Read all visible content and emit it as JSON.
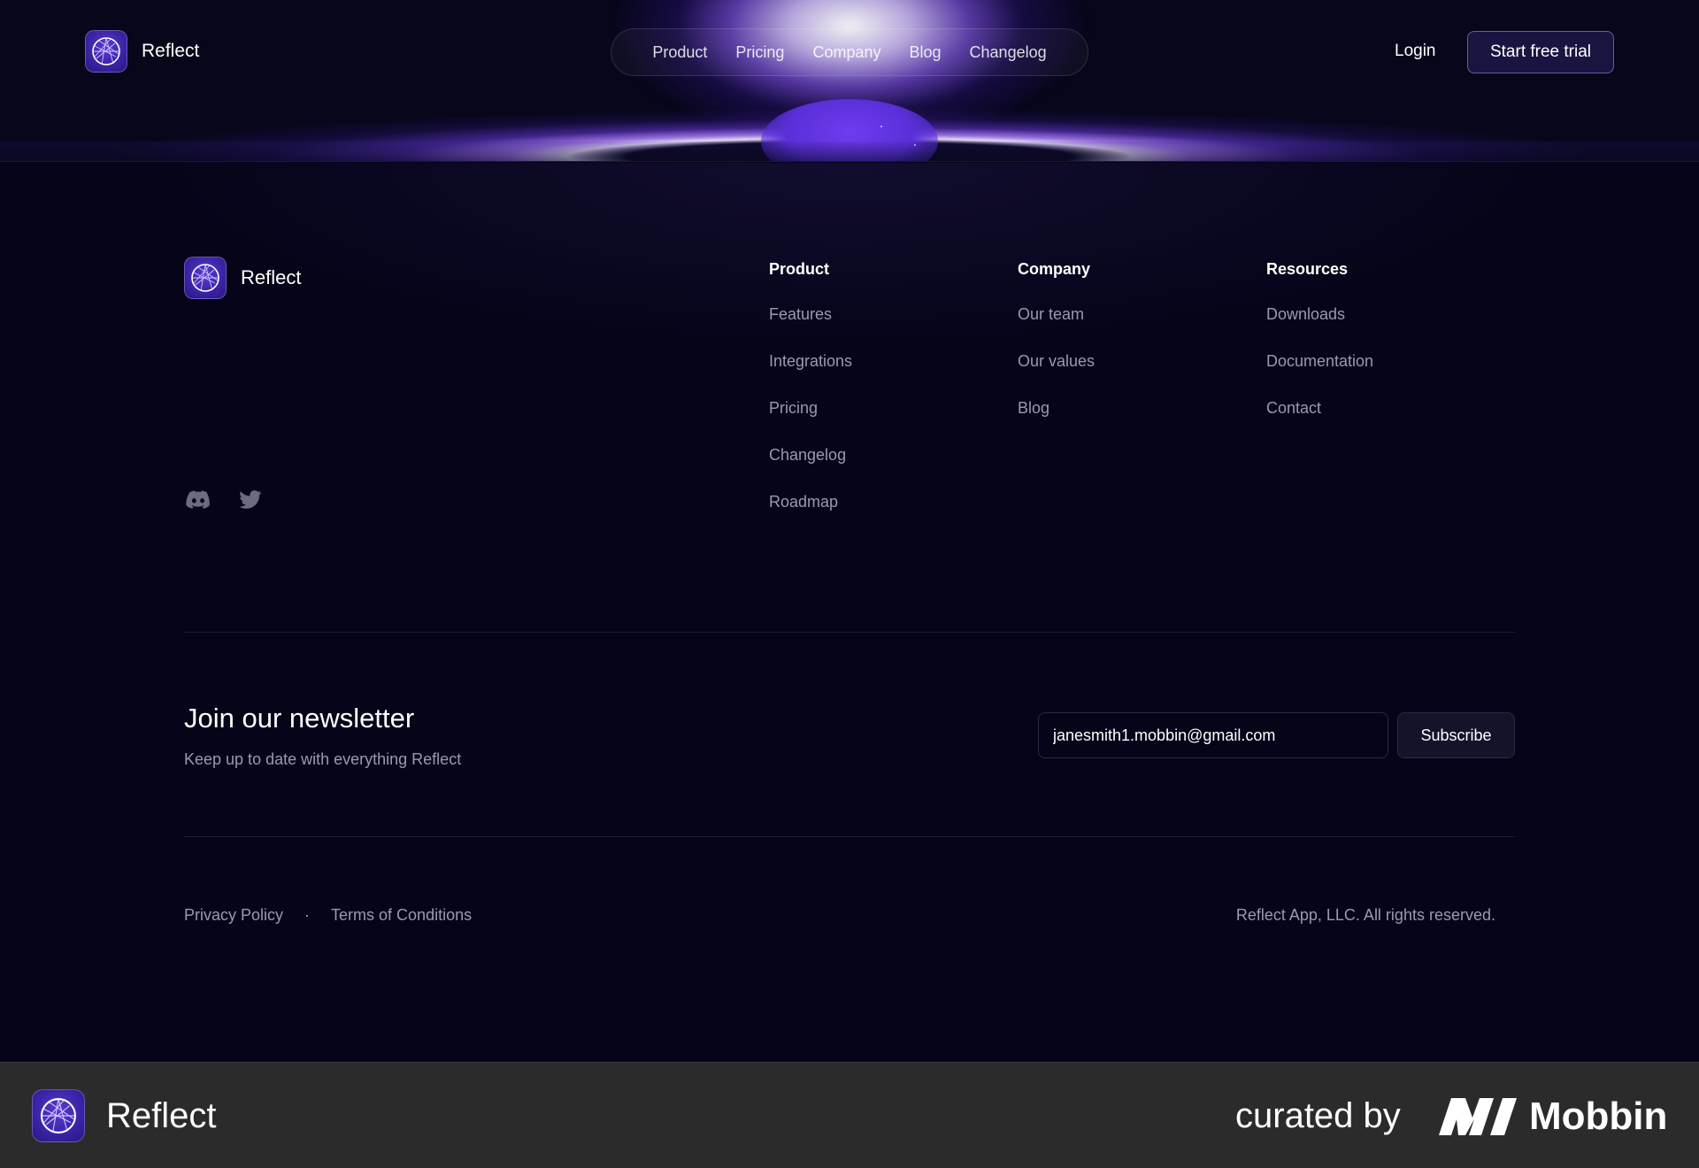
{
  "nav": {
    "brand": "Reflect",
    "links": [
      "Product",
      "Pricing",
      "Company",
      "Blog",
      "Changelog"
    ],
    "login": "Login",
    "trial": "Start free trial"
  },
  "footer": {
    "brand": "Reflect",
    "columns": [
      {
        "title": "Product",
        "items": [
          "Features",
          "Integrations",
          "Pricing",
          "Changelog",
          "Roadmap"
        ]
      },
      {
        "title": "Company",
        "items": [
          "Our team",
          "Our values",
          "Blog"
        ]
      },
      {
        "title": "Resources",
        "items": [
          "Downloads",
          "Documentation",
          "Contact"
        ]
      }
    ],
    "social": [
      "discord-icon",
      "twitter-icon"
    ],
    "newsletter": {
      "title": "Join our newsletter",
      "subtitle": "Keep up to date with everything Reflect",
      "email_value": "janesmith1.mobbin@gmail.com",
      "subscribe": "Subscribe"
    },
    "legal": {
      "privacy": "Privacy Policy",
      "separator": "·",
      "terms": "Terms of Conditions"
    },
    "copyright": "Reflect App, LLC. All rights reserved."
  },
  "bottom_bar": {
    "brand": "Reflect",
    "curated_by": "curated by",
    "mobbin": "Mobbin"
  },
  "colors": {
    "background": "#050418",
    "accent": "#6f3cf0",
    "muted_text": "#9a9aae",
    "bottom_bar": "#2b2b2b"
  }
}
